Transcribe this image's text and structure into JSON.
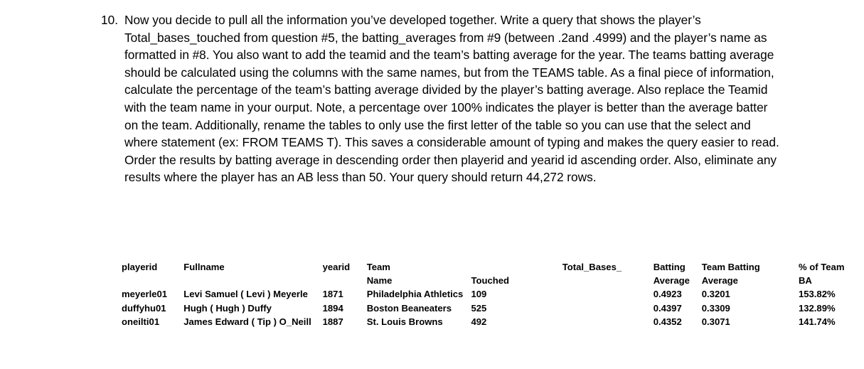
{
  "question": {
    "number": "10.",
    "text": "Now you decide to pull all the information you’ve developed together. Write a query that shows the player’s Total_bases_touched from question #5, the batting_averages from #9 (between .2and .4999) and the player’s name as formatted in #8. You also want to add the teamid and the team’s batting average for the year. The teams batting average should be calculated using the columns with the same names, but from the TEAMS table.  As a final piece of information, calculate the percentage of the team’s batting average divided by the player’s batting average. Also replace the Teamid with the team name in your ourput. Note, a percentage over 100% indicates the player is better than the average batter on the team.  Additionally, rename the tables to only use the first letter of the table so you can use that the select and where statement (ex: FROM TEAMS T). This saves a considerable amount of typing and makes the query easier to read. Order the results by batting average in descending order then playerid and yearid id ascending order. Also, eliminate any results where the player has an AB less than 50. Your query should return 44,272 rows."
  },
  "result_table": {
    "headers_line1": {
      "playerid": "playerid",
      "fullname": "Fullname",
      "yearid": "yearid",
      "team": "Team",
      "touched_spacer": "",
      "total_bases": "Total_Bases_",
      "batting": "Batting",
      "team_batting": "Team Batting",
      "pct_of_team": "% of Team"
    },
    "headers_line2": {
      "playerid": "",
      "fullname": "",
      "yearid": "",
      "team": "Name",
      "touched": "Touched",
      "total_bases": "",
      "batting": "Average",
      "team_batting": "Average",
      "pct_of_team": "BA"
    },
    "rows": [
      {
        "playerid": "meyerle01",
        "fullname": "Levi Samuel ( Levi ) Meyerle",
        "yearid": "1871",
        "team_name": "Philadelphia Athletics",
        "total_bases_touched": "109",
        "batting_average": "0.4923",
        "team_batting_average": "0.3201",
        "pct_of_team_ba": "153.82%"
      },
      {
        "playerid": "duffyhu01",
        "fullname": "Hugh ( Hugh ) Duffy",
        "yearid": "1894",
        "team_name": "Boston Beaneaters",
        "total_bases_touched": "525",
        "batting_average": "0.4397",
        "team_batting_average": "0.3309",
        "pct_of_team_ba": "132.89%"
      },
      {
        "playerid": "oneilti01",
        "fullname": "James Edward ( Tip ) O_Neill",
        "yearid": "1887",
        "team_name": "St. Louis Browns",
        "total_bases_touched": "492",
        "batting_average": "0.4352",
        "team_batting_average": "0.3071",
        "pct_of_team_ba": "141.74%"
      }
    ]
  }
}
